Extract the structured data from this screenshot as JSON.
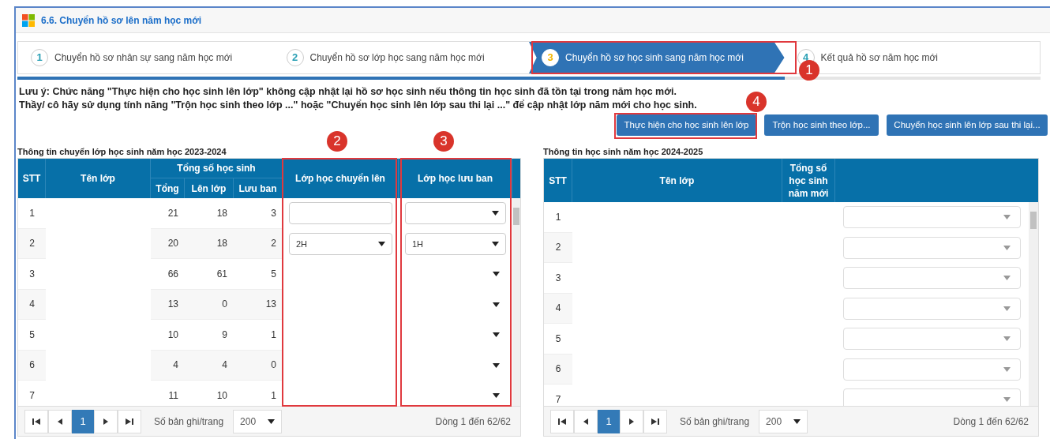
{
  "title": "6.6. Chuyển hồ sơ lên năm học mới",
  "steps": [
    {
      "number": "1",
      "label": "Chuyển hồ sơ nhân sự sang năm học mới",
      "selected": false
    },
    {
      "number": "2",
      "label": "Chuyển hồ sơ lớp học sang năm học mới",
      "selected": false
    },
    {
      "number": "3",
      "label": "Chuyển hồ sơ học sinh sang năm học mới",
      "selected": true
    },
    {
      "number": "4",
      "label": "Kết quả hồ sơ năm học mới",
      "selected": false
    }
  ],
  "progress": {
    "level": 0.75
  },
  "notes": [
    "Lưu ý: Chức năng \"Thực hiện cho học sinh lên lớp\" không cập nhật lại hồ sơ học sinh nếu thông tin học sinh đã tồn tại trong năm học mới.",
    "Thầy/ cô hãy sử dụng tính năng \"Trộn học sinh theo lớp ...\" hoặc \"Chuyển học sinh lên lớp sau thi lại ...\" để cập nhật lớp năm mới cho học sinh."
  ],
  "buttons": [
    "Thực hiện cho học sinh lên lớp",
    "Trộn học sinh theo lớp...",
    "Chuyển học sinh lên lớp sau thi lại..."
  ],
  "callouts": [
    "1",
    "2",
    "3",
    "4"
  ],
  "left_table": {
    "title": "Thông tin chuyển lớp học sinh năm học 2023-2024",
    "columns": {
      "stt": "STT",
      "class_name": "Tên lớp",
      "total_group": "Tổng số học sinh",
      "total": "Tổng",
      "promoted": "Lên lớp",
      "retained": "Lưu ban",
      "promote_to": "Lớp học chuyển lên",
      "retain_in": "Lớp học lưu ban"
    },
    "rows": [
      {
        "stt": "1",
        "total": "21",
        "promoted": "18",
        "retained": "3",
        "promote_to": {
          "kind": "input"
        },
        "retain_in": {
          "kind": "select"
        }
      },
      {
        "stt": "2",
        "total": "20",
        "promoted": "18",
        "retained": "2",
        "promote_to": {
          "kind": "select",
          "value": "2H"
        },
        "retain_in": {
          "kind": "select",
          "value": "1H"
        }
      },
      {
        "stt": "3",
        "total": "66",
        "promoted": "61",
        "retained": "5",
        "promote_to": {
          "kind": "blank"
        },
        "retain_in": {
          "kind": "arrow"
        }
      },
      {
        "stt": "4",
        "total": "13",
        "promoted": "0",
        "retained": "13",
        "promote_to": {
          "kind": "blank"
        },
        "retain_in": {
          "kind": "arrow"
        }
      },
      {
        "stt": "5",
        "total": "10",
        "promoted": "9",
        "retained": "1",
        "promote_to": {
          "kind": "blank"
        },
        "retain_in": {
          "kind": "arrow"
        }
      },
      {
        "stt": "6",
        "total": "4",
        "promoted": "4",
        "retained": "0",
        "promote_to": {
          "kind": "blank"
        },
        "retain_in": {
          "kind": "arrow"
        }
      },
      {
        "stt": "7",
        "total": "11",
        "promoted": "10",
        "retained": "1",
        "promote_to": {
          "kind": "blank"
        },
        "retain_in": {
          "kind": "arrow"
        }
      }
    ],
    "pager": {
      "pages": [
        {
          "label": "1",
          "selected": true
        }
      ],
      "page_size_label": "Số bản ghi/trang",
      "page_size": "200",
      "summary": "Dòng 1 đến 62/62"
    }
  },
  "right_table": {
    "title": "Thông tin học sinh năm học 2024-2025",
    "columns": {
      "stt": "STT",
      "class_name": "Tên lớp",
      "new_total": "Tổng số học sinh năm mới"
    },
    "rows": [
      {
        "stt": "1"
      },
      {
        "stt": "2"
      },
      {
        "stt": "3"
      },
      {
        "stt": "4"
      },
      {
        "stt": "5"
      },
      {
        "stt": "6"
      },
      {
        "stt": "7"
      }
    ],
    "pager": {
      "pages": [
        {
          "label": "1",
          "selected": true
        }
      ],
      "page_size_label": "Số bản ghi/trang",
      "page_size": "200",
      "summary": "Dòng 1 đến 62/62"
    }
  }
}
